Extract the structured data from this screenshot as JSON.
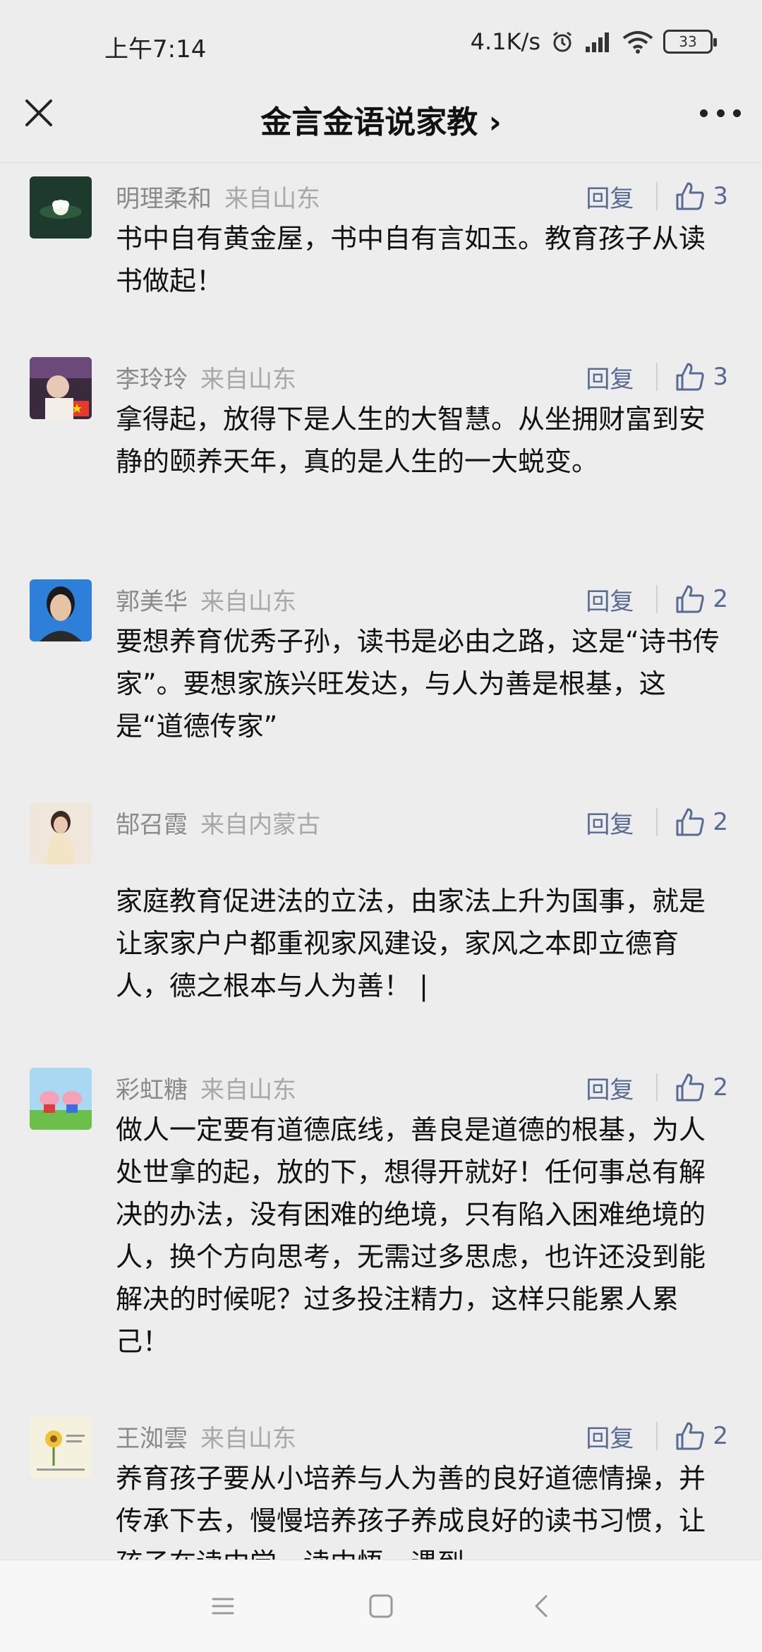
{
  "status": {
    "time": "上午7:14",
    "speed": "4.1K/s",
    "battery": "33"
  },
  "header": {
    "title": "金言金语说家教 ›"
  },
  "comments": [
    {
      "name": "明理柔和",
      "location": "来自山东",
      "reply": "回复",
      "likes": "3",
      "text": "书中自有黄金屋，书中自有言如玉。教育孩子从读书做起！"
    },
    {
      "name": "李玲玲",
      "location": "来自山东",
      "reply": "回复",
      "likes": "3",
      "text": "拿得起，放得下是人生的大智慧。从坐拥财富到安静的颐养天年，真的是人生的一大蜕变。"
    },
    {
      "name": "郭美华",
      "location": "来自山东",
      "reply": "回复",
      "likes": "2",
      "text": "要想养育优秀子孙，读书是必由之路，这是“诗书传家”。要想家族兴旺发达，与人为善是根基，这是“道德传家”"
    },
    {
      "name": "郜召霞",
      "location": "来自内蒙古",
      "reply": "回复",
      "likes": "2",
      "text": "家庭教育促进法的立法，由家法上升为国事，就是让家家户户都重视家风建设，家风之本即立德育人，德之根本与人为善！ |"
    },
    {
      "name": "彩虹糖",
      "location": "来自山东",
      "reply": "回复",
      "likes": "2",
      "text": "做人一定要有道德底线，善良是道德的根基，为人处世拿的起，放的下，想得开就好！任何事总有解决的办法，没有困难的绝境，只有陷入困难绝境的人，换个方向思考，无需过多思虑，也许还没到能解决的时候呢？过多投注精力，这样只能累人累己！"
    },
    {
      "name": "王洳雲",
      "location": "来自山东",
      "reply": "回复",
      "likes": "2",
      "text": "养育孩子要从小培养与人为善的良好道德情操，并传承下去，慢慢培养孩子养成良好的读书习惯，让孩子在读中学，读中悟，遇到"
    }
  ]
}
